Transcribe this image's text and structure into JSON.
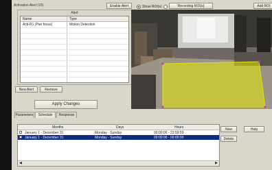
{
  "window": {
    "title": "Activation Alert (15)",
    "enable_label": "Enable Alert"
  },
  "view_mode": [
    {
      "label": "Show ROI(s)",
      "selected": true
    },
    {
      "label": "Recording ROI(s)",
      "selected": false
    }
  ],
  "add_roi_label": "Add ROI",
  "alerts": {
    "legend": "Alert",
    "columns": [
      "Name",
      "Type"
    ],
    "rows": [
      {
        "name": "Acti-R1 (Pan focus)",
        "type": "Motion Detection"
      }
    ]
  },
  "buttons": {
    "new_alert": "New Alert",
    "remove": "Remove",
    "apply": "Apply Changes",
    "new": "New",
    "delete": "Delete",
    "help": "Help"
  },
  "tabs": [
    "Parameters",
    "Schedule",
    "Response"
  ],
  "active_tab": "Schedule",
  "schedule": {
    "columns": [
      "",
      "Months",
      "Days",
      "Hours"
    ],
    "rows": [
      {
        "months": "January 1 - December 31",
        "days": "Monday - Sunday",
        "hours": "00:00:00 - 23:59:59",
        "selected": false
      },
      {
        "months": "January 1 - December 31",
        "days": "Monday - Sunday",
        "hours": "00:00:00 - 00:00:00",
        "selected": true
      }
    ]
  },
  "colors": {
    "roi": "#e4e600",
    "handle": "#c040c0",
    "selection": "#0a2a8c"
  }
}
